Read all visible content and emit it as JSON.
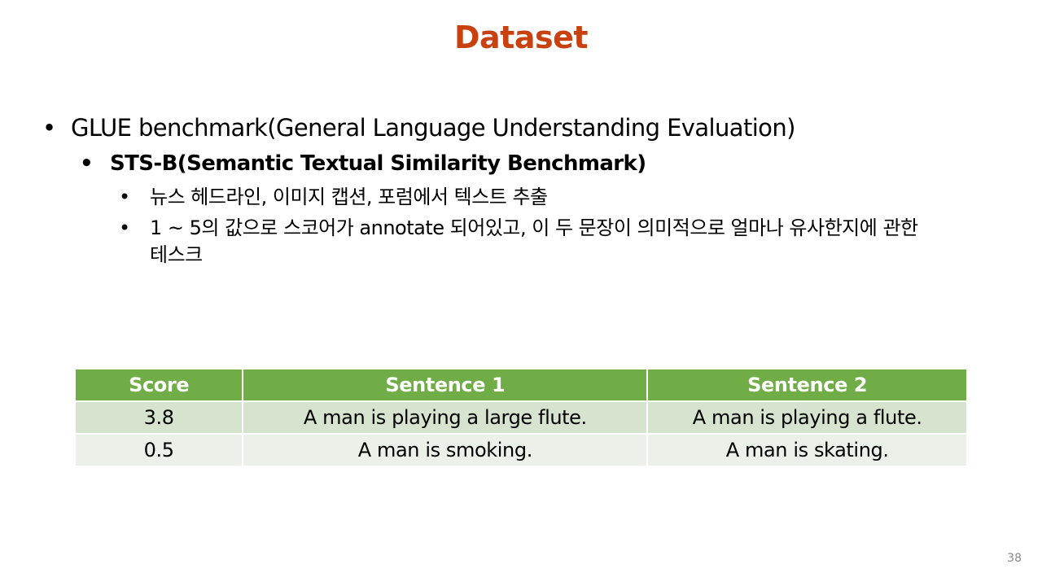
{
  "title": "Dataset",
  "bullets": {
    "level1": "GLUE benchmark(General Language Understanding Evaluation)",
    "level2": "STS-B(Semantic Textual Similarity Benchmark)",
    "level3": [
      "뉴스 헤드라인, 이미지 캡션, 포럼에서 텍스트 추출",
      "1 ~ 5의 값으로 스코어가 annotate 되어있고, 이 두 문장이 의미적으로 얼마나 유사한지에 관한 테스크"
    ],
    "bullet_glyph": "•"
  },
  "table": {
    "headers": [
      "Score",
      "Sentence 1",
      "Sentence 2"
    ],
    "rows": [
      [
        "3.8",
        "A man is playing a large flute.",
        "A man is playing a flute."
      ],
      [
        "0.5",
        "A man is smoking.",
        "A man is skating."
      ]
    ],
    "header_color": "#70ad47",
    "row_colors": [
      "#d5e3cf",
      "#ebf1e9"
    ]
  },
  "title_color": "#c9410f",
  "page_number": "38"
}
